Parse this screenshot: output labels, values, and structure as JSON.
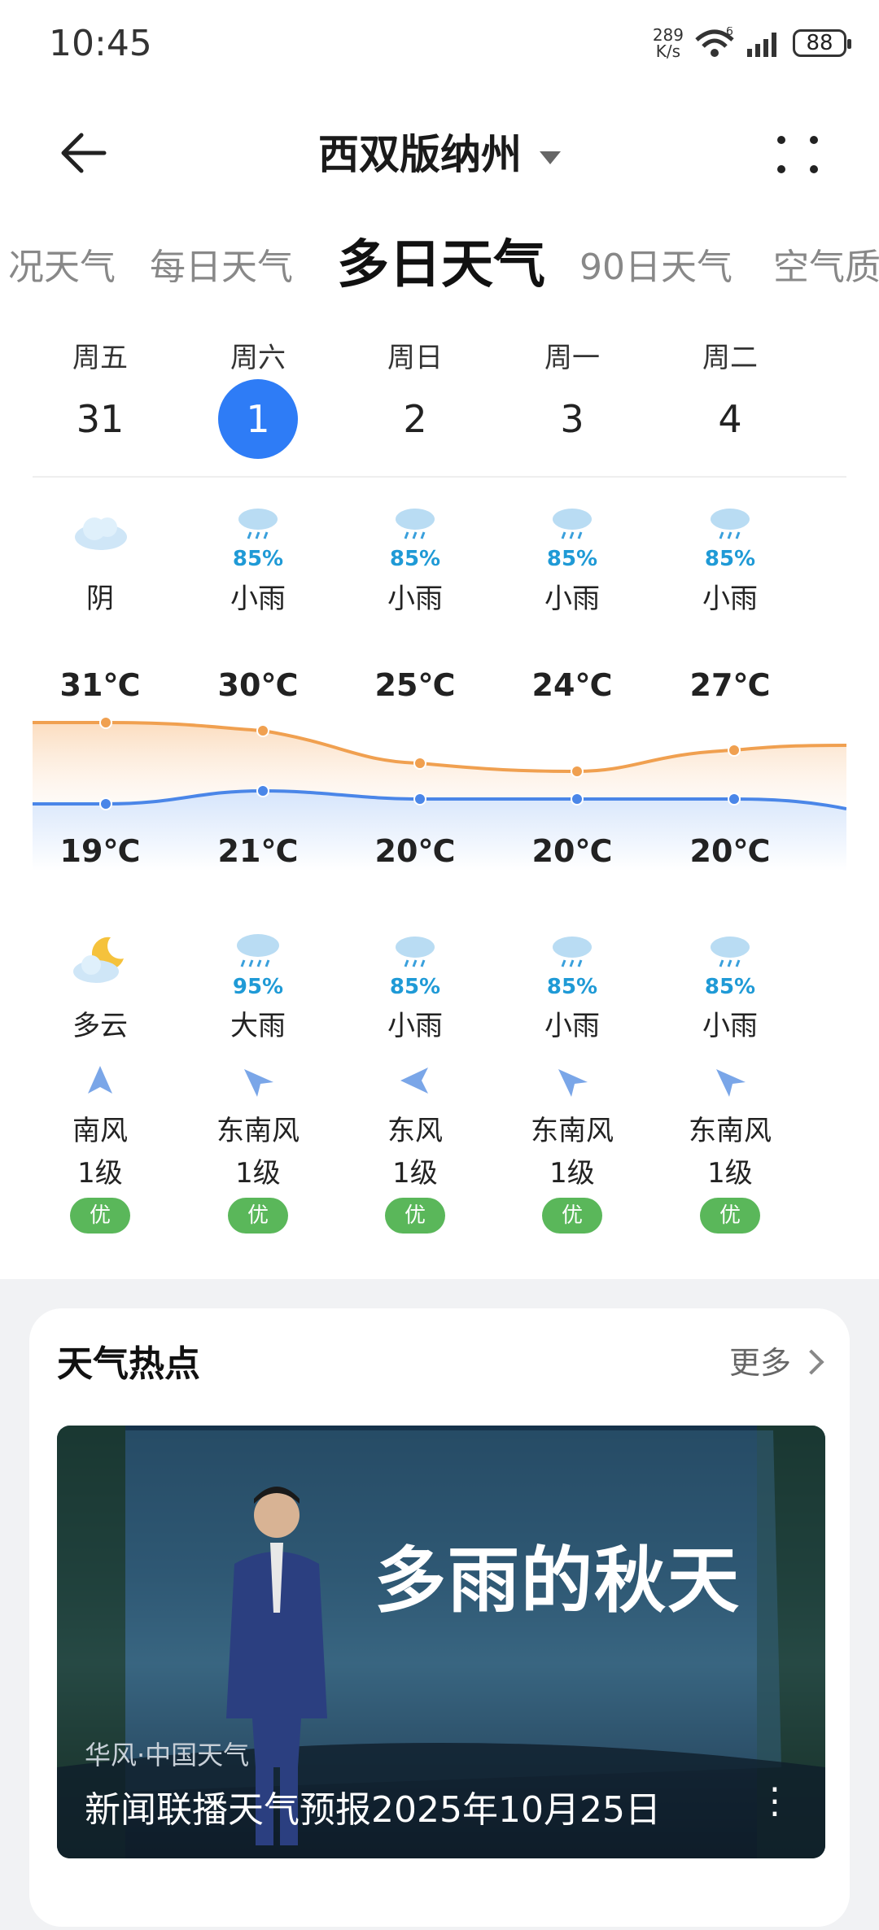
{
  "status": {
    "time": "10:45",
    "speed_value": "289",
    "speed_unit": "K/s",
    "network": "6",
    "battery": "88"
  },
  "header": {
    "city": "西双版纳州"
  },
  "tabs": [
    "况天气",
    "每日天气",
    "多日天气",
    "90日天气",
    "空气质"
  ],
  "days": [
    {
      "dow": "周五",
      "date": "31",
      "day_cond": "阴",
      "day_pct": "",
      "high": "31℃",
      "low": "19℃",
      "night_cond": "多云",
      "night_pct": "",
      "wind_dir": "南风",
      "wind_level": "1级",
      "aqi": "优"
    },
    {
      "dow": "周六",
      "date": "1",
      "day_cond": "小雨",
      "day_pct": "85%",
      "high": "30℃",
      "low": "21℃",
      "night_cond": "大雨",
      "night_pct": "95%",
      "wind_dir": "东南风",
      "wind_level": "1级",
      "aqi": "优"
    },
    {
      "dow": "周日",
      "date": "2",
      "day_cond": "小雨",
      "day_pct": "85%",
      "high": "25℃",
      "low": "20℃",
      "night_cond": "小雨",
      "night_pct": "85%",
      "wind_dir": "东风",
      "wind_level": "1级",
      "aqi": "优"
    },
    {
      "dow": "周一",
      "date": "3",
      "day_cond": "小雨",
      "day_pct": "85%",
      "high": "24℃",
      "low": "20℃",
      "night_cond": "小雨",
      "night_pct": "85%",
      "wind_dir": "东南风",
      "wind_level": "1级",
      "aqi": "优"
    },
    {
      "dow": "周二",
      "date": "4",
      "day_cond": "小雨",
      "day_pct": "85%",
      "high": "27℃",
      "low": "20℃",
      "night_cond": "小雨",
      "night_pct": "85%",
      "wind_dir": "东南风",
      "wind_level": "1级",
      "aqi": "优"
    }
  ],
  "selected_index": 1,
  "hot": {
    "title": "天气热点",
    "more": "更多",
    "video_headline": "多雨的秋天",
    "video_source": "华风·中国天气",
    "video_title": "新闻联播天气预报2025年10月25日"
  },
  "colors": {
    "accent": "#2e7cf6",
    "high_line": "#f0a050",
    "low_line": "#4a86e8",
    "aqi_good": "#5ab75a"
  }
}
